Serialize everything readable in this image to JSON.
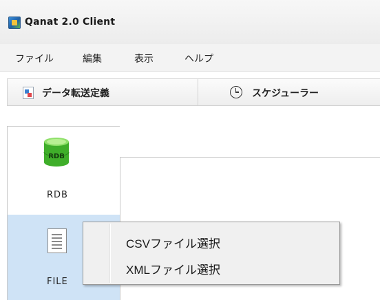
{
  "window": {
    "title": "Qanat 2.0 Client"
  },
  "menubar": {
    "items": [
      "ファイル",
      "編集",
      "表示",
      "ヘルプ"
    ]
  },
  "toolbar": {
    "tabs": [
      {
        "label": "データ転送定義",
        "icon": "document-icon"
      },
      {
        "label": "スケジューラー",
        "icon": "clock-icon"
      }
    ]
  },
  "sidebar": {
    "items": [
      {
        "label": "RDB",
        "icon": "database-icon",
        "icon_text": "RDB",
        "selected": false
      },
      {
        "label": "FILE",
        "icon": "file-icon",
        "selected": true
      }
    ]
  },
  "context_menu": {
    "items": [
      "CSVファイル選択",
      "XMLファイル選択"
    ]
  },
  "colors": {
    "selected_bg": "#cfe3f6",
    "db_green": "#3fae2a"
  }
}
